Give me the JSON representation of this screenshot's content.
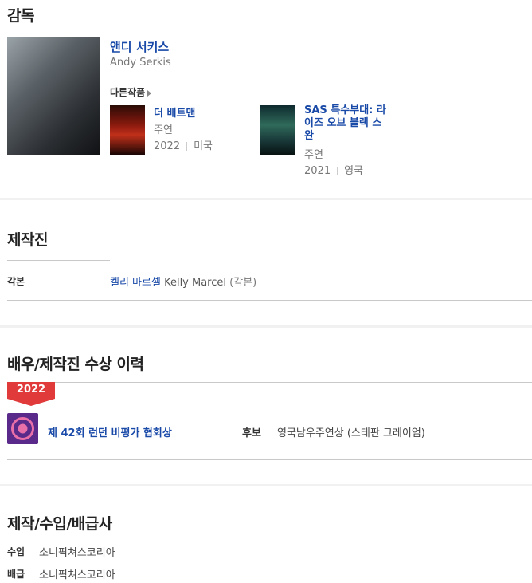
{
  "director": {
    "section_title": "감독",
    "name_ko": "앤디 서키스",
    "name_en": "Andy Serkis",
    "other_works_label": "다른작품",
    "works": [
      {
        "title": "더 배트맨",
        "role": "주연",
        "year": "2022",
        "country": "미국"
      },
      {
        "title": "SAS 특수부대: 라이즈 오브 블랙 스완",
        "role": "주연",
        "year": "2021",
        "country": "영국"
      }
    ]
  },
  "crew": {
    "section_title": "제작진",
    "rows": [
      {
        "role": "각본",
        "name_ko": "켈리 마르셀",
        "name_en": "Kelly Marcel",
        "note": "(각본)"
      }
    ]
  },
  "awards": {
    "section_title": "배우/제작진 수상 이력",
    "year_badge": "2022",
    "items": [
      {
        "name": "제 42회 런던 비평가 협회상",
        "status": "후보",
        "detail": "영국남우주연상 (스테판 그레이엄)"
      }
    ]
  },
  "companies": {
    "section_title": "제작/수입/배급사",
    "rows": [
      {
        "type": "수입",
        "name": "소니픽쳐스코리아"
      },
      {
        "type": "배급",
        "name": "소니픽쳐스코리아"
      }
    ]
  }
}
